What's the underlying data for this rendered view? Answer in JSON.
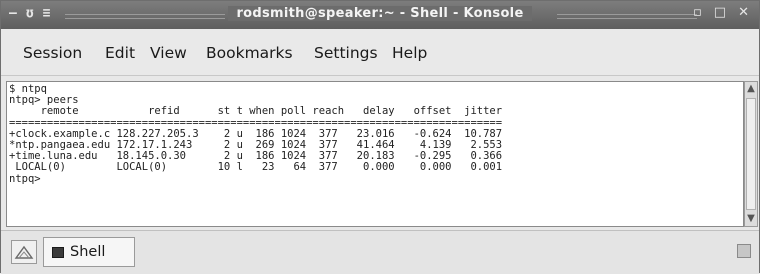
{
  "window": {
    "title": "rodsmith@speaker:~ - Shell - Konsole",
    "left_controls": [
      "–",
      "ʊ",
      "≡"
    ],
    "right_controls": [
      "▫",
      "□",
      "✕"
    ]
  },
  "menubar": {
    "items": [
      "Session",
      "Edit",
      "View",
      "Bookmarks",
      "Settings",
      "Help"
    ]
  },
  "terminal": {
    "lines": [
      "$ ntpq",
      "ntpq> peers",
      "     remote           refid      st t when poll reach   delay   offset  jitter",
      "==============================================================================",
      "+clock.example.c 128.227.205.3    2 u  186 1024  377   23.016   -0.624  10.787",
      "*ntp.pangaea.edu 172.17.1.243     2 u  269 1024  377   41.464    4.139   2.553",
      "+time.luna.edu   18.145.0.30      2 u  186 1024  377   20.183   -0.295   0.366",
      " LOCAL(0)        LOCAL(0)        10 l   23   64  377    0.000    0.000   0.001",
      "ntpq>"
    ]
  },
  "tabbar": {
    "tabs": [
      {
        "label": "Shell"
      }
    ]
  },
  "colors": {
    "titlebar": "#6c6c6c",
    "terminal_bg": "#ffffff",
    "terminal_text": "#222222"
  }
}
